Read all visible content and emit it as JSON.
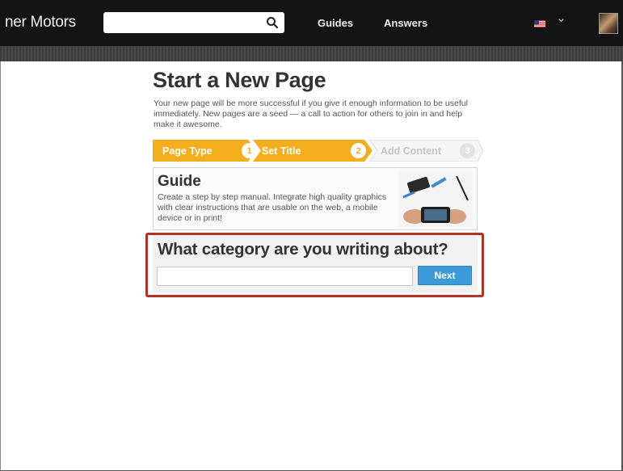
{
  "header": {
    "brand": "ner Motors",
    "search": {
      "value": "",
      "placeholder": "",
      "icon": "search-icon"
    },
    "nav": {
      "guides": "Guides",
      "answers": "Answers"
    },
    "locale_icon": "us-flag-icon",
    "menu_icon": "chevron-down-icon",
    "avatar_icon": "user-avatar"
  },
  "main": {
    "title": "Start a New Page",
    "intro": "Your new page will be more successful if you give it enough information to be useful immediately. New pages are a seed — a call to action for others to join in and help make it awesome.",
    "steps": [
      {
        "label": "Page Type",
        "number": "1",
        "state": "active"
      },
      {
        "label": "Set Title",
        "number": "2",
        "state": "active"
      },
      {
        "label": "Add Content",
        "number": "3",
        "state": "inactive"
      }
    ],
    "page_type_card": {
      "title": "Guide",
      "description": "Create a step by step manual. Integrate high quality graphics with clear instructions that are usable on the web, a mobile device or in print!",
      "image": "phone-repair-photo"
    },
    "category": {
      "question": "What category are you writing about?",
      "input_value": "",
      "input_placeholder": "",
      "next_label": "Next"
    }
  },
  "colors": {
    "topbar": "#141414",
    "accent_orange": "#f4ae1c",
    "button_blue": "#3d9ad9",
    "highlight_red": "#b33224"
  }
}
